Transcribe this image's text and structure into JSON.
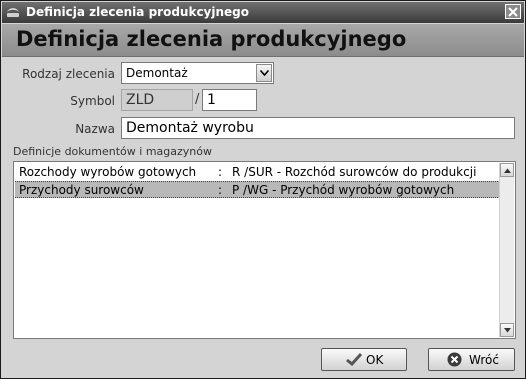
{
  "window": {
    "title": "Definicja zlecenia produkcyjnego",
    "icon": "app-icon",
    "close_icon": "close-icon"
  },
  "header": {
    "title": "Definicja zlecenia produkcyjnego"
  },
  "form": {
    "rodzaj": {
      "label": "Rodzaj zlecenia",
      "value": "Demontaż"
    },
    "symbol": {
      "label": "Symbol",
      "prefix": "ZLD",
      "separator": "/",
      "number": "1"
    },
    "nazwa": {
      "label": "Nazwa",
      "value": "Demontaż wyrobu"
    }
  },
  "definitions": {
    "label": "Definicje dokumentów i magazynów",
    "rows": [
      {
        "name": "Rozchody wyrobów gotowych",
        "colon": ":",
        "doc": "R /SUR - Rozchód surowców do produkcji",
        "selected": false
      },
      {
        "name": "Przychody surowców",
        "colon": ":",
        "doc": "P /WG  - Przychód wyrobów gotowych",
        "selected": true
      }
    ]
  },
  "buttons": {
    "ok": {
      "label": "OK",
      "icon": "checkmark-icon"
    },
    "back": {
      "label": "Wróć",
      "icon": "cancel-icon"
    }
  },
  "colors": {
    "titlebar": "#4a4a4a",
    "header_band": "#9a9a9a",
    "selection": "#b8b8b8"
  }
}
